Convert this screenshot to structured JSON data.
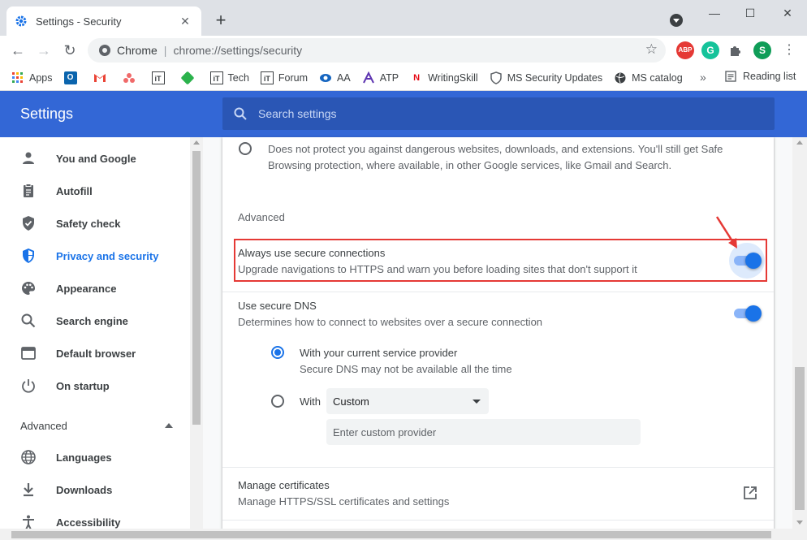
{
  "tab": {
    "title": "Settings - Security",
    "close": "✕",
    "new_tab": "+"
  },
  "window": {
    "minimize": "—",
    "maximize": "☐",
    "close": "✕"
  },
  "toolbar": {
    "back": "←",
    "forward": "→",
    "reload": "↻",
    "omnibox_label": "Chrome",
    "omnibox_separator": "|",
    "url": "chrome://settings/security",
    "star": "☆",
    "extensions": {
      "abp": "ABP",
      "grammarly": "G",
      "profile": "S",
      "menu": "⋮"
    }
  },
  "bookmarks": {
    "items": [
      {
        "label": "Apps",
        "icon": "apps-grid-icon"
      },
      {
        "label": "",
        "icon": "outlook-icon"
      },
      {
        "label": "",
        "icon": "gmail-icon"
      },
      {
        "label": "",
        "icon": "asana-icon"
      },
      {
        "label": "",
        "icon": "itechtics-icon"
      },
      {
        "label": "",
        "icon": "feedly-icon"
      },
      {
        "label": "Tech",
        "icon": "itechtics-icon"
      },
      {
        "label": "Forum",
        "icon": "itechtics-icon"
      },
      {
        "label": "AA",
        "icon": "eye-icon"
      },
      {
        "label": "ATP",
        "icon": "atp-icon"
      },
      {
        "label": "WritingSkill",
        "icon": "netflix-icon"
      },
      {
        "label": "MS Security Updates",
        "icon": "shield-icon"
      },
      {
        "label": "MS catalog",
        "icon": "globe-icon"
      }
    ],
    "more": "»",
    "reading_list": "Reading list"
  },
  "header": {
    "title": "Settings",
    "search_placeholder": "Search settings"
  },
  "sidebar": {
    "items": [
      {
        "label": "You and Google",
        "icon": "person-icon"
      },
      {
        "label": "Autofill",
        "icon": "clipboard-icon"
      },
      {
        "label": "Safety check",
        "icon": "shield-check-icon"
      },
      {
        "label": "Privacy and security",
        "icon": "shield-half-icon",
        "active": true
      },
      {
        "label": "Appearance",
        "icon": "palette-icon"
      },
      {
        "label": "Search engine",
        "icon": "search-icon"
      },
      {
        "label": "Default browser",
        "icon": "browser-window-icon"
      },
      {
        "label": "On startup",
        "icon": "power-icon"
      }
    ],
    "advanced_label": "Advanced",
    "advanced_items": [
      {
        "label": "Languages",
        "icon": "globe-icon"
      },
      {
        "label": "Downloads",
        "icon": "download-icon"
      },
      {
        "label": "Accessibility",
        "icon": "accessibility-icon"
      }
    ]
  },
  "main": {
    "no_protection": {
      "description_line1": "Does not protect you against dangerous websites, downloads, and extensions. You'll still get Safe",
      "description_line2": "Browsing protection, where available, in other Google services, like Gmail and Search."
    },
    "advanced_heading": "Advanced",
    "secure_connections": {
      "title": "Always use secure connections",
      "description": "Upgrade navigations to HTTPS and warn you before loading sites that don't support it",
      "enabled": true
    },
    "secure_dns": {
      "title": "Use secure DNS",
      "description": "Determines how to connect to websites over a secure connection",
      "enabled": true,
      "option_current": {
        "title": "With your current service provider",
        "description": "Secure DNS may not be available all the time",
        "selected": true
      },
      "option_with": {
        "label": "With",
        "selected": false,
        "dropdown_value": "Custom",
        "custom_placeholder": "Enter custom provider"
      }
    },
    "certificates": {
      "title": "Manage certificates",
      "description": "Manage HTTPS/SSL certificates and settings"
    }
  },
  "colors": {
    "accent": "#1a73e8",
    "header": "#3367d6",
    "highlight": "#e53935"
  }
}
